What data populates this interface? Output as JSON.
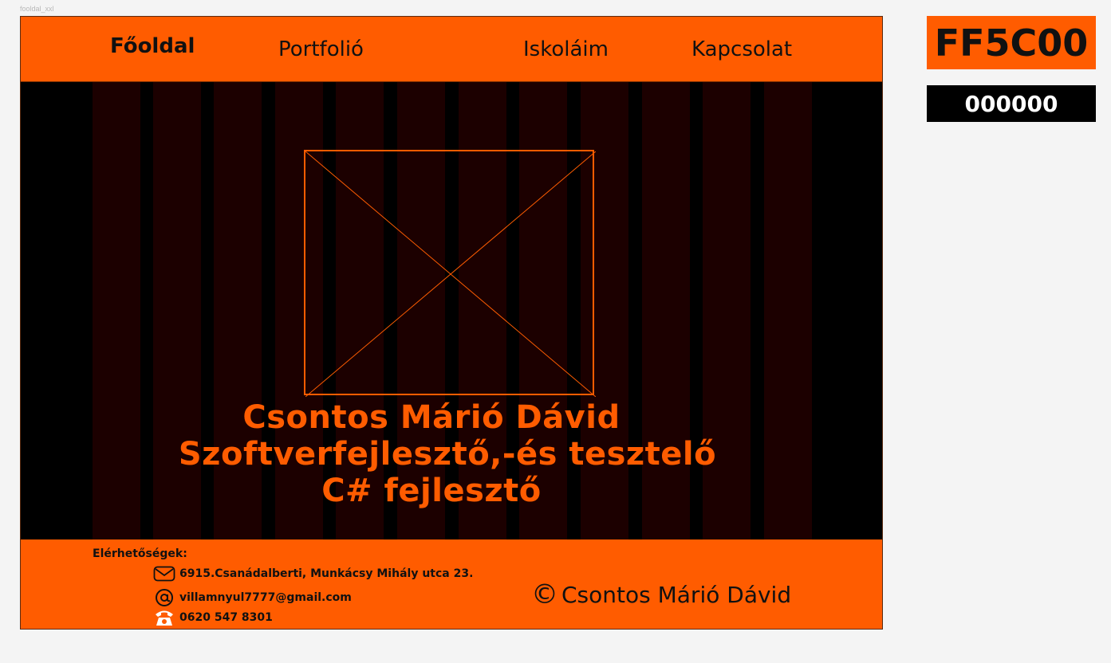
{
  "frame": {
    "label": "fooldal_xxl"
  },
  "nav": {
    "items": [
      {
        "label": "Főoldal",
        "active": true
      },
      {
        "label": "Portfolió",
        "active": false
      },
      {
        "label": "Iskoláim",
        "active": false
      },
      {
        "label": "Kapcsolat",
        "active": false
      }
    ]
  },
  "hero": {
    "image_placeholder": "image-placeholder-icon",
    "lines": [
      "Csontos Márió Dávid",
      "Szoftverfejlesztő,-és tesztelő",
      "C# fejlesztő"
    ]
  },
  "footer": {
    "contacts_heading": "Elérhetőségek:",
    "address": "6915.Csanádalberti, Munkácsy Mihály utca 23.",
    "email": "villamnyul7777@gmail.com",
    "phone": "0620 547 8301",
    "copyright": "Csontos Márió Dávid",
    "icons": {
      "address": "envelope-icon",
      "email": "at-sign-icon",
      "phone": "telephone-icon",
      "copyright": "copyright-icon"
    }
  },
  "palette": {
    "primary_label": "FF5C00",
    "secondary_label": "000000",
    "primary_color": "#ff5c00",
    "secondary_color": "#000000"
  }
}
